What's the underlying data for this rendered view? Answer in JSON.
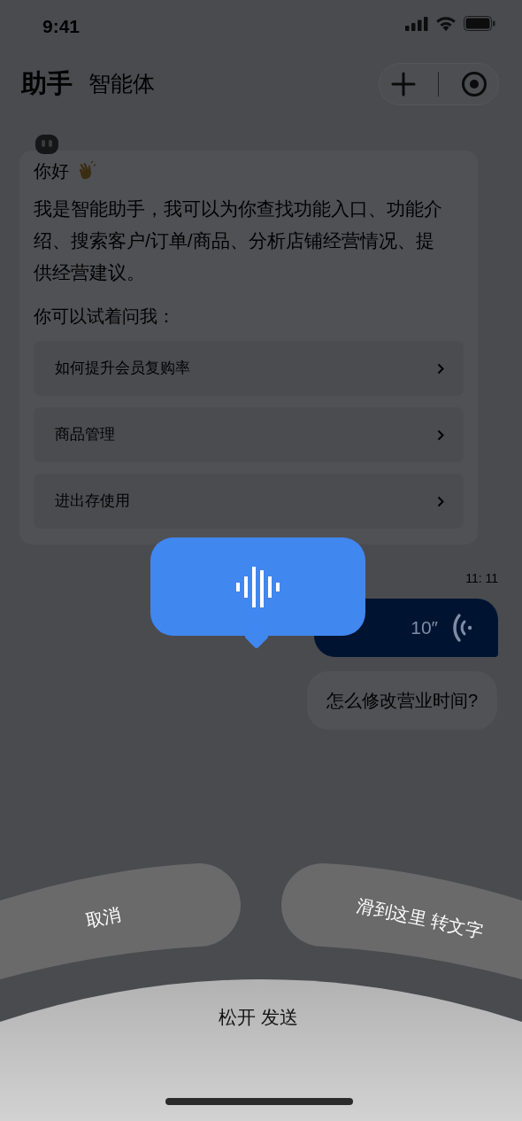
{
  "status_bar": {
    "time": "9:41"
  },
  "header": {
    "tabs": [
      {
        "label": "助手",
        "selected": true
      },
      {
        "label": "智能体",
        "selected": false
      }
    ]
  },
  "welcome_card": {
    "greeting": "你好",
    "intro": "我是智能助手，我可以为你查找功能入口、功能介绍、搜索客户/订单/商品、分析店铺经营情况、提供经营建议。",
    "prompt": "你可以试着问我：",
    "suggestions": [
      "如何提升会员复购率",
      "商品管理",
      "进出存使用"
    ]
  },
  "messages": [
    {
      "kind": "time",
      "text": "11: 11"
    },
    {
      "kind": "voice",
      "duration": "10″"
    },
    {
      "kind": "text",
      "text": "怎么修改营业时间?"
    }
  ],
  "recording": {
    "cancel": "取消",
    "convert": "滑到这里 转文字",
    "release": "松开 发送"
  }
}
